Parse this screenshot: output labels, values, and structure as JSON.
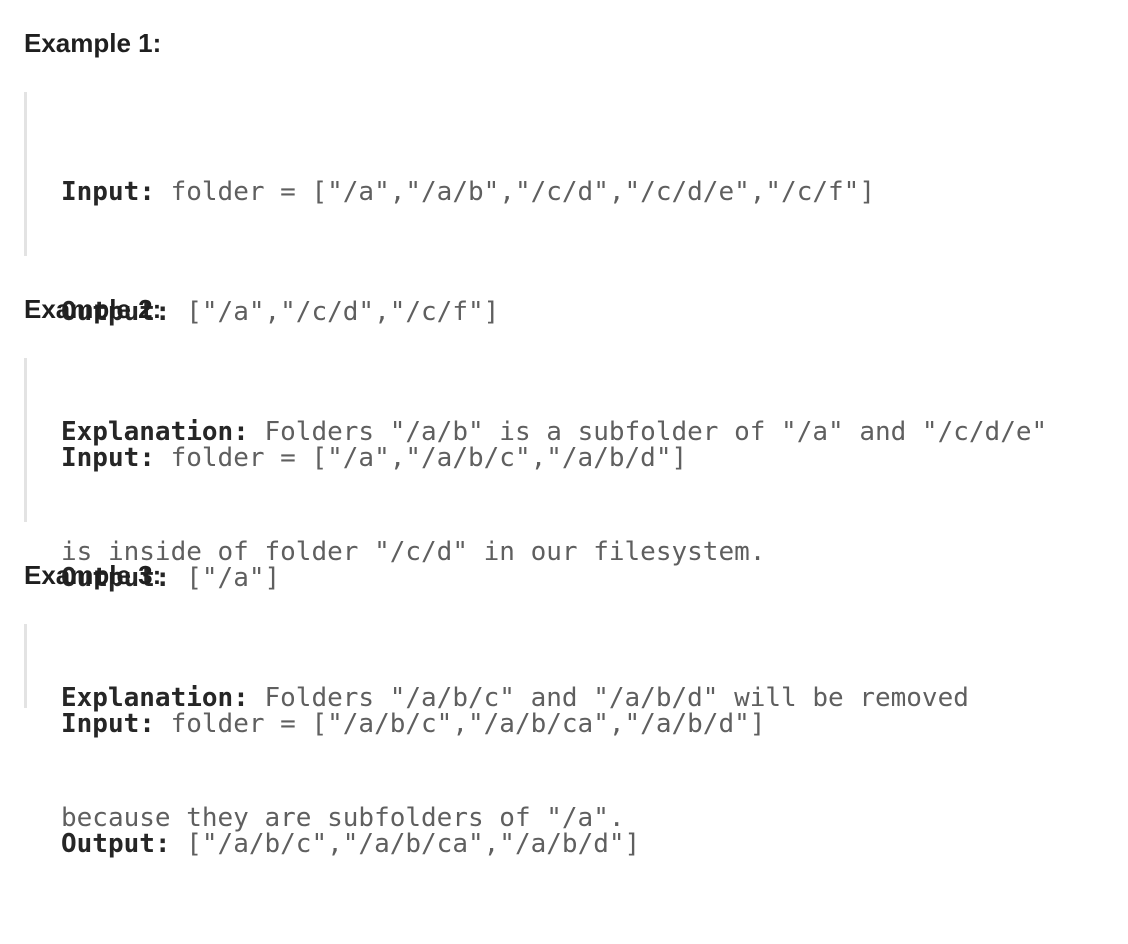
{
  "examples": [
    {
      "heading": "Example 1:",
      "input_label": "Input:",
      "input_value": " folder = [\"/a\",\"/a/b\",\"/c/d\",\"/c/d/e\",\"/c/f\"]",
      "output_label": "Output:",
      "output_value": " [\"/a\",\"/c/d\",\"/c/f\"]",
      "explanation_label": "Explanation:",
      "explanation_value_line1": " Folders \"/a/b\" is a subfolder of \"/a\" and \"/c/d/e\"",
      "explanation_value_line2": "is inside of folder \"/c/d\" in our filesystem."
    },
    {
      "heading": "Example 2:",
      "input_label": "Input:",
      "input_value": " folder = [\"/a\",\"/a/b/c\",\"/a/b/d\"]",
      "output_label": "Output:",
      "output_value": " [\"/a\"]",
      "explanation_label": "Explanation:",
      "explanation_value_line1": " Folders \"/a/b/c\" and \"/a/b/d\" will be removed",
      "explanation_value_line2": "because they are subfolders of \"/a\"."
    },
    {
      "heading": "Example 3:",
      "input_label": "Input:",
      "input_value": " folder = [\"/a/b/c\",\"/a/b/ca\",\"/a/b/d\"]",
      "output_label": "Output:",
      "output_value": " [\"/a/b/c\",\"/a/b/ca\",\"/a/b/d\"]"
    }
  ]
}
